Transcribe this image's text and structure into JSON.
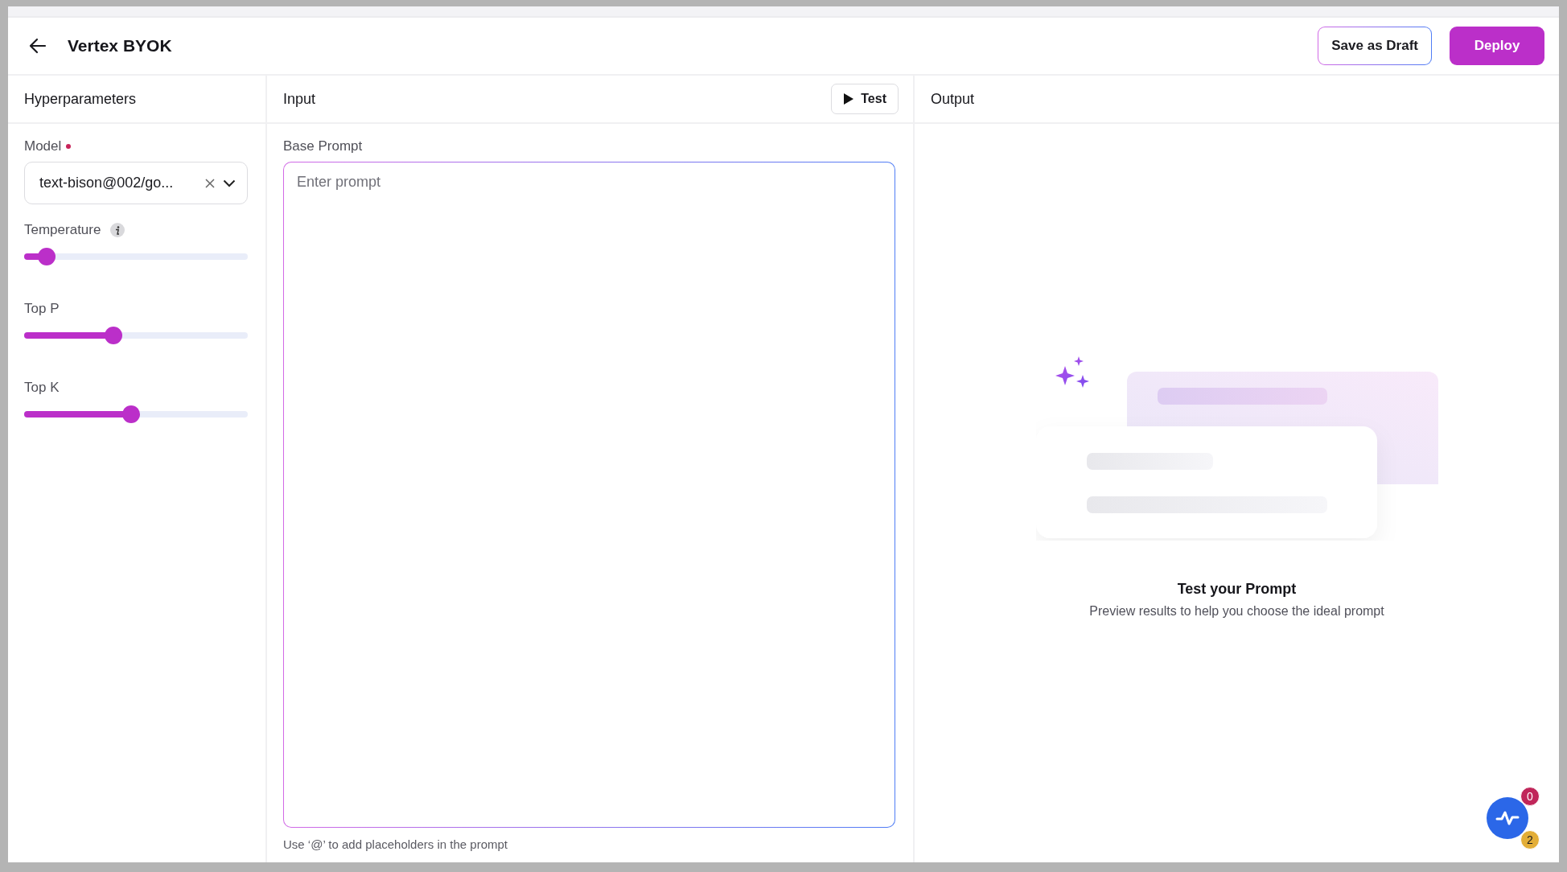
{
  "header": {
    "title": "Vertex BYOK",
    "buttons": [
      {
        "label": "Save as Draft",
        "kind": "outline"
      },
      {
        "label": "Deploy",
        "kind": "primary"
      }
    ]
  },
  "hyperparameters": {
    "title": "Hyperparameters",
    "model": {
      "label": "Model",
      "required": true,
      "value": "text-bison@002/go..."
    },
    "sliders": [
      {
        "label": "Temperature",
        "info": true,
        "level": 0.1
      },
      {
        "label": "Top P",
        "info": false,
        "level": 0.4
      },
      {
        "label": "Top K",
        "info": false,
        "level": 0.48
      }
    ]
  },
  "input": {
    "title": "Input",
    "test_button": "Test",
    "field_label": "Base Prompt",
    "placeholder": "Enter prompt",
    "hint": "Use ‘@’ to add placeholders in the prompt"
  },
  "output": {
    "title": "Output",
    "empty_title": "Test your Prompt",
    "empty_text": "Preview results to help you choose the ideal prompt"
  },
  "activity_widget": {
    "badges": [
      {
        "count": "0",
        "color": "#c0265a"
      },
      {
        "count": "2",
        "color": "#e3ae37"
      }
    ]
  }
}
